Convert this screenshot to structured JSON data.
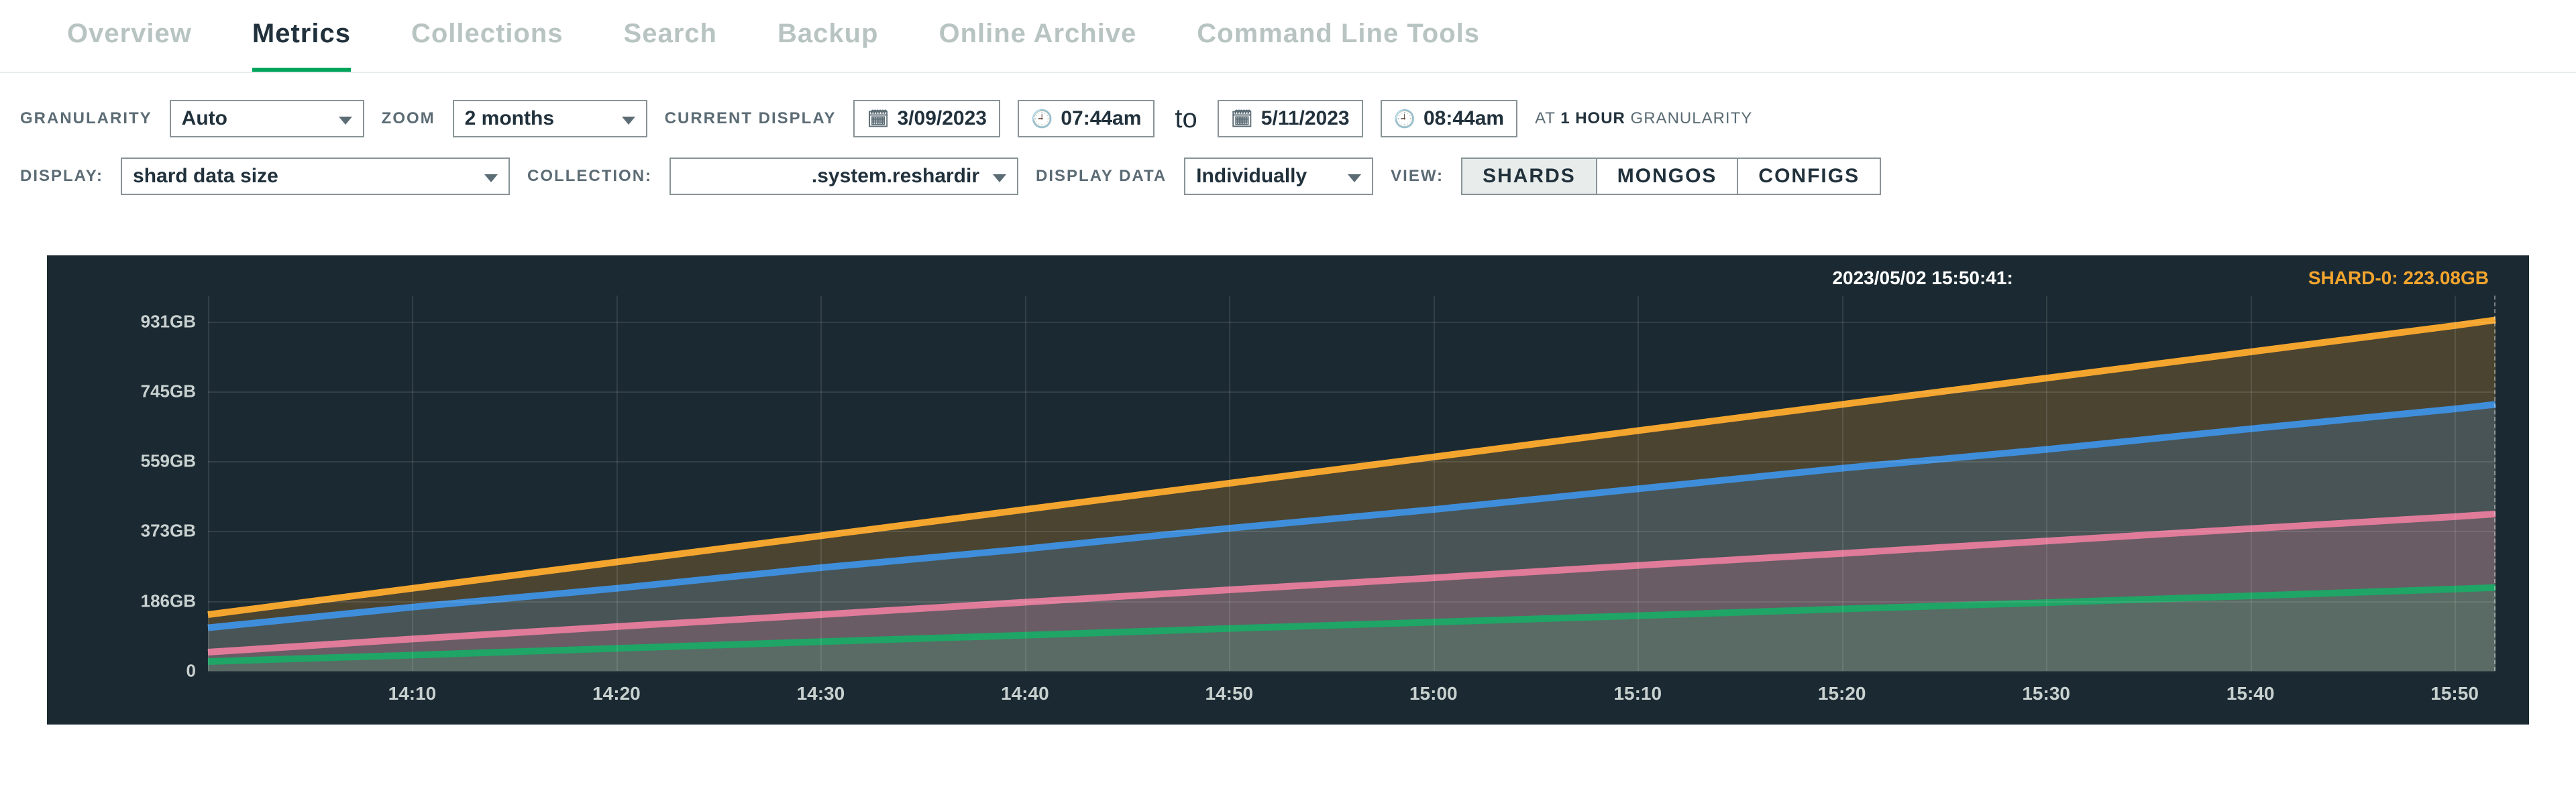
{
  "tabs": {
    "items": [
      "Overview",
      "Metrics",
      "Collections",
      "Search",
      "Backup",
      "Online Archive",
      "Command Line Tools"
    ],
    "active": "Metrics"
  },
  "toolbar": {
    "granularity_label": "GRANULARITY",
    "granularity_value": "Auto",
    "zoom_label": "ZOOM",
    "zoom_value": "2 months",
    "current_display_label": "CURRENT DISPLAY",
    "from_date": "3/09/2023",
    "from_time": "07:44am",
    "to_word": "to",
    "to_date": "5/11/2023",
    "to_time": "08:44am",
    "at_label_pre": "AT ",
    "at_label_bold": "1 HOUR",
    "at_label_post": " GRANULARITY",
    "display_label": "DISPLAY:",
    "display_value": "shard data size",
    "collection_label": "COLLECTION:",
    "collection_value": ".system.reshardir",
    "display_data_label": "DISPLAY DATA",
    "display_data_value": "Individually",
    "view_label": "VIEW:",
    "view_buttons": [
      "SHARDS",
      "MONGOS",
      "CONFIGS"
    ],
    "view_active": "SHARDS"
  },
  "chart_data": {
    "type": "line",
    "title": "",
    "ylabel": "",
    "y_ticks": [
      0,
      186,
      373,
      559,
      745,
      931
    ],
    "y_tick_labels": [
      "0",
      "186GB",
      "373GB",
      "559GB",
      "745GB",
      "931GB"
    ],
    "x_ticks": [
      "14:10",
      "14:20",
      "14:30",
      "14:40",
      "14:50",
      "15:00",
      "15:10",
      "15:20",
      "15:30",
      "15:40",
      "15:50"
    ],
    "xlim": [
      "14:00",
      "15:52"
    ],
    "ylim": [
      0,
      1000
    ],
    "hover": {
      "timestamp": "2023/05/02 15:50:41:",
      "series_label": "SHARD-0",
      "series_value": "223.08GB"
    },
    "x": [
      0,
      10,
      20,
      30,
      40,
      50,
      60,
      70,
      80,
      90,
      100,
      110,
      112
    ],
    "series": [
      {
        "name": "orange",
        "color": "#F4A52E",
        "values": [
          150,
          220,
          290,
          360,
          430,
          500,
          570,
          640,
          710,
          780,
          850,
          920,
          935
        ]
      },
      {
        "name": "blue",
        "color": "#3F8EDB",
        "values": [
          115,
          170,
          220,
          275,
          325,
          380,
          430,
          485,
          540,
          590,
          645,
          698,
          710
        ]
      },
      {
        "name": "pink",
        "color": "#E07B9A",
        "values": [
          50,
          85,
          118,
          150,
          183,
          216,
          248,
          281,
          313,
          346,
          379,
          411,
          418
        ]
      },
      {
        "name": "green",
        "color": "#1FA566",
        "values": [
          25,
          42,
          60,
          78,
          95,
          113,
          130,
          147,
          165,
          182,
          200,
          218,
          222
        ]
      }
    ]
  }
}
